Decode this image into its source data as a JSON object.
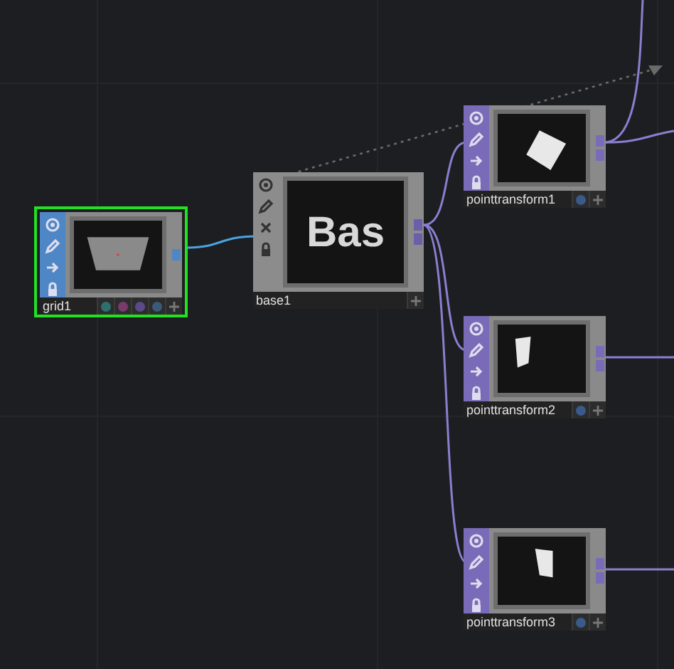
{
  "nodes": [
    {
      "name": "grid1",
      "kind": "sop",
      "selected": true,
      "color": "#4f86c6",
      "flags": [
        {
          "color": "#2f6f6f"
        },
        {
          "color": "#7a3a6a"
        },
        {
          "color": "#5a4a8a"
        },
        {
          "color": "#3a5a7a"
        }
      ]
    },
    {
      "name": "base1",
      "kind": "comp",
      "selected": false,
      "color": "#8c8c8c",
      "preview_text": "Bas"
    },
    {
      "name": "pointtransform1",
      "kind": "sop",
      "selected": false,
      "color": "#7a6bb8",
      "flags": [
        {
          "color": "#3a5a8a"
        }
      ]
    },
    {
      "name": "pointtransform2",
      "kind": "sop",
      "selected": false,
      "color": "#7a6bb8",
      "flags": [
        {
          "color": "#3a5a8a"
        }
      ]
    },
    {
      "name": "pointtransform3",
      "kind": "sop",
      "selected": false,
      "color": "#7a6bb8",
      "flags": [
        {
          "color": "#3a5a8a"
        }
      ]
    }
  ]
}
